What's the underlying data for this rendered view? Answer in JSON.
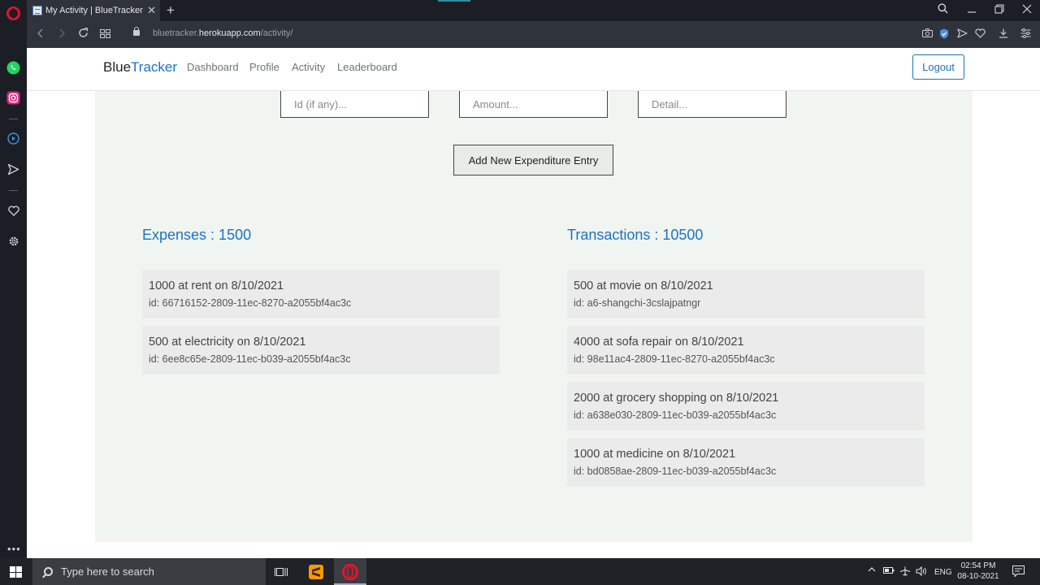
{
  "browser": {
    "tab_title": "My Activity | BlueTracker",
    "tab_close": "✕",
    "new_tab": "+",
    "url_host_prefix": "bluetracker.",
    "url_host_main": "herokuapp.com",
    "url_path": "/activity/"
  },
  "navbar": {
    "brand_part1": "Blue",
    "brand_part2": "Tracker",
    "links": [
      "Dashboard",
      "Profile",
      "Activity",
      "Leaderboard"
    ],
    "logout_label": "Logout"
  },
  "form": {
    "id_placeholder": "Id (if any)...",
    "amount_placeholder": "Amount...",
    "detail_placeholder": "Detail...",
    "submit_label": "Add New Expenditure Entry"
  },
  "expenses": {
    "heading": "Expenses : 1500",
    "items": [
      {
        "title": "1000 at rent on 8/10/2021",
        "id": "id: 66716152-2809-11ec-8270-a2055bf4ac3c"
      },
      {
        "title": "500 at electricity on 8/10/2021",
        "id": "id: 6ee8c65e-2809-11ec-b039-a2055bf4ac3c"
      }
    ]
  },
  "transactions": {
    "heading": "Transactions : 10500",
    "items": [
      {
        "title": "500 at movie on 8/10/2021",
        "id": "id: a6-shangchi-3cslajpatngr"
      },
      {
        "title": "4000 at sofa repair on 8/10/2021",
        "id": "id: 98e11ac4-2809-11ec-8270-a2055bf4ac3c"
      },
      {
        "title": "2000 at grocery shopping on 8/10/2021",
        "id": "id: a638e030-2809-11ec-b039-a2055bf4ac3c"
      },
      {
        "title": "1000 at medicine on 8/10/2021",
        "id": "id: bd0858ae-2809-11ec-b039-a2055bf4ac3c"
      }
    ]
  },
  "taskbar": {
    "search_placeholder": "Type here to search",
    "language": "ENG",
    "time": "02:54 PM",
    "date": "08-10-2021"
  },
  "colors": {
    "accent": "#1b73c4",
    "content_bg": "#f1f5f1",
    "entry_bg": "#ebebeb",
    "browser_dark": "#1b1e24"
  },
  "icons": [
    "opera-logo",
    "whatsapp-icon",
    "instagram-icon",
    "player-icon",
    "send-icon",
    "heart-icon",
    "settings-icon",
    "search-icon",
    "windows-logo",
    "task-view-icon",
    "sublime-icon",
    "opera-taskbar-icon"
  ]
}
